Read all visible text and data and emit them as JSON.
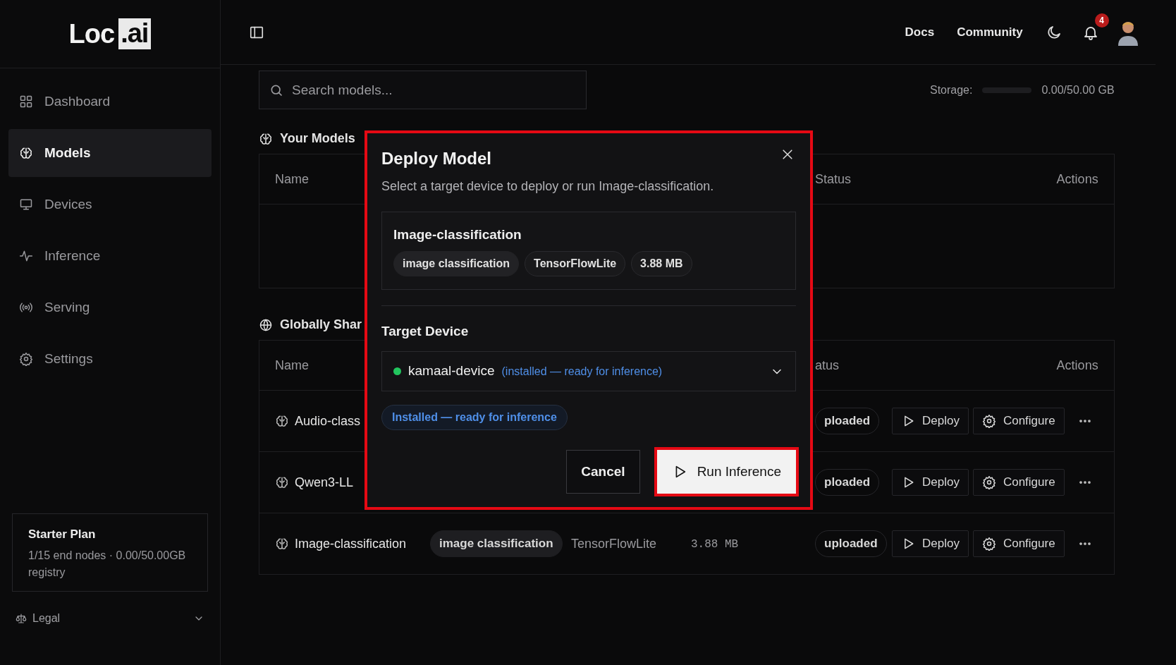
{
  "brand": {
    "name": "Loc",
    "suffix": ".ai"
  },
  "sidebar": {
    "items": [
      {
        "label": "Dashboard",
        "selected": false
      },
      {
        "label": "Models",
        "selected": true
      },
      {
        "label": "Devices",
        "selected": false
      },
      {
        "label": "Inference",
        "selected": false
      },
      {
        "label": "Serving",
        "selected": false
      },
      {
        "label": "Settings",
        "selected": false
      }
    ],
    "plan": {
      "title": "Starter Plan",
      "detail": "1/15 end nodes · 0.00/50.00GB registry"
    },
    "legal": {
      "label": "Legal",
      "expanded": false
    }
  },
  "header": {
    "links": [
      "Docs",
      "Community"
    ],
    "notifications": "4"
  },
  "search": {
    "placeholder": "Search models..."
  },
  "storage": {
    "label": "Storage:",
    "level": 0,
    "reading": "0.00/50.00 GB"
  },
  "your_models": {
    "title": "Your Models",
    "columns": [
      "Name",
      "Status",
      "Actions"
    ]
  },
  "shared": {
    "title": "Globally Shar",
    "columns": [
      "Name",
      "atus",
      "Actions"
    ],
    "rows": [
      {
        "name": "Audio-class",
        "status": "ploaded",
        "actions": [
          "Deploy",
          "Configure"
        ]
      },
      {
        "name": "Qwen3-LL",
        "status": "ploaded",
        "actions": [
          "Deploy",
          "Configure"
        ]
      },
      {
        "name": "Image-classification",
        "tag": "image classification",
        "framework": "TensorFlowLite",
        "size": "3.88 MB",
        "status": "uploaded",
        "actions": [
          "Deploy",
          "Configure"
        ]
      }
    ]
  },
  "dialog": {
    "title": "Deploy Model",
    "description": "Select a target device to deploy or run Image-classification.",
    "highlighted": true,
    "model": {
      "name": "Image-classification",
      "tags": [
        "image classification",
        "TensorFlowLite",
        "3.88 MB"
      ]
    },
    "target_label": "Target Device",
    "device": {
      "name": "kamaal-device",
      "note": "(installed — ready for inference)",
      "color": "#22c55e"
    },
    "status_pill": "Installed — ready for inference",
    "buttons": [
      {
        "label": "Cancel",
        "kind": "secondary",
        "highlighted": false
      },
      {
        "label": "Run Inference",
        "kind": "primary",
        "highlighted": true
      }
    ]
  }
}
